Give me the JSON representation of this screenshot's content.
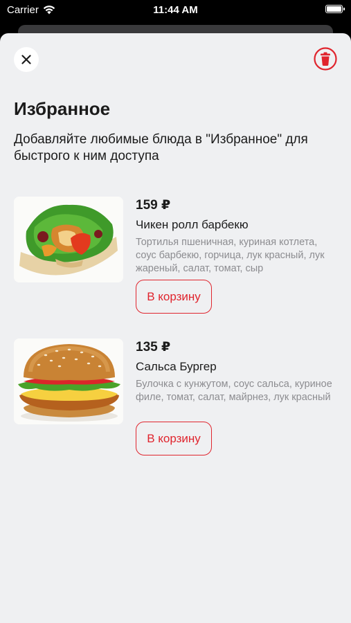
{
  "status_bar": {
    "carrier": "Carrier",
    "time": "11:44 AM"
  },
  "header": {
    "close_icon": "close-icon",
    "trash_icon": "trash-icon",
    "accent_color": "#e0242d"
  },
  "page": {
    "title": "Избранное",
    "subtitle": "Добавляйте любимые блюда в \"Избранное\" для быстрого к ним доступа"
  },
  "items": [
    {
      "price": "159 ₽",
      "name": "Чикен ролл барбекю",
      "description": "Тортилья пшеничная, куриная котлета, соус барбекю, горчица, лук красный, лук жареный, салат, томат, сыр",
      "button": "В корзину",
      "image": "chicken-roll-image"
    },
    {
      "price": "135 ₽",
      "name": "Сальса Бургер",
      "description": "Булочка с кунжутом, соус сальса, куриное филе, томат, салат, майрнез, лук красный",
      "button": "В корзину",
      "image": "burger-image"
    }
  ]
}
